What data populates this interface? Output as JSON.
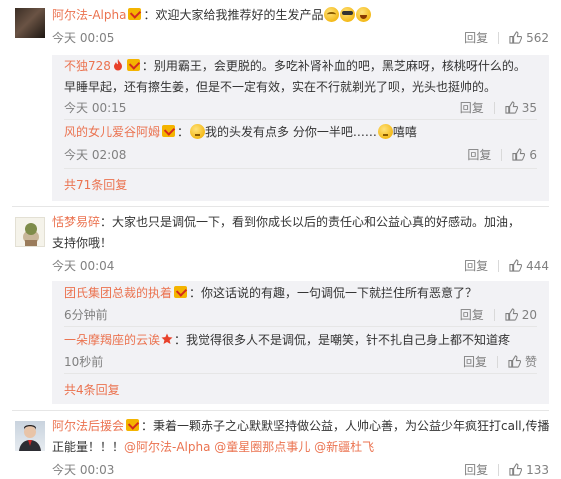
{
  "labels": {
    "reply": "回复",
    "like_word": "赞"
  },
  "comments": [
    {
      "user": "阿尔法-Alpha",
      "text": "：欢迎大家给我推荐好的生发产品",
      "emojis": [
        "cry",
        "cool",
        "laugh"
      ],
      "time": "今天 00:05",
      "likes": "562",
      "replies": [
        {
          "user": "不独728",
          "text_line1": "：别用霸王，会更脱的。多吃补肾补血的吧，黑芝麻呀，核桃呀什么的。",
          "text_line2": "早睡早起，还有擦生姜，但是不一定有效，实在不行就剃光了呗，光头也挺帅的。",
          "time": "今天 00:15",
          "likes": "35"
        },
        {
          "user": "风的女儿爱谷阿姆",
          "text_a": "我的头发有点多 分你一半吧……",
          "text_b": "嘻嘻",
          "time": "今天 02:08",
          "likes": "6"
        }
      ],
      "more": "共71条回复"
    },
    {
      "user": "恬梦易碎",
      "text_line1": "：大家也只是调侃一下，看到你成长以后的责任心和公益心真的好感动。加油，",
      "text_line2": "支持你哦！",
      "time": "今天 00:04",
      "likes": "444",
      "replies": [
        {
          "user": "团氏集团总裁的执着",
          "text": "：你这话说的有趣，一句调侃一下就拦住所有恶意了？",
          "time": "6分钟前",
          "likes": "20"
        },
        {
          "user": "一朵摩羯座的云诶",
          "text": "：我觉得很多人不是调侃，是嘲笑，针不扎自己身上都不知道疼",
          "time": "10秒前",
          "likes": "赞"
        }
      ],
      "more": "共4条回复"
    },
    {
      "user": "阿尔法后援会",
      "text_line1": "：秉着一颗赤子之心默默坚持做公益，人帅心善，为公益少年疯狂打call,传播",
      "text_line2a": "正能量！！！",
      "mention1": "@阿尔法-Alpha",
      "mention2": "@童星圈那点事儿",
      "mention3": "@新疆杜飞",
      "time": "今天 00:03",
      "likes": "133"
    }
  ]
}
